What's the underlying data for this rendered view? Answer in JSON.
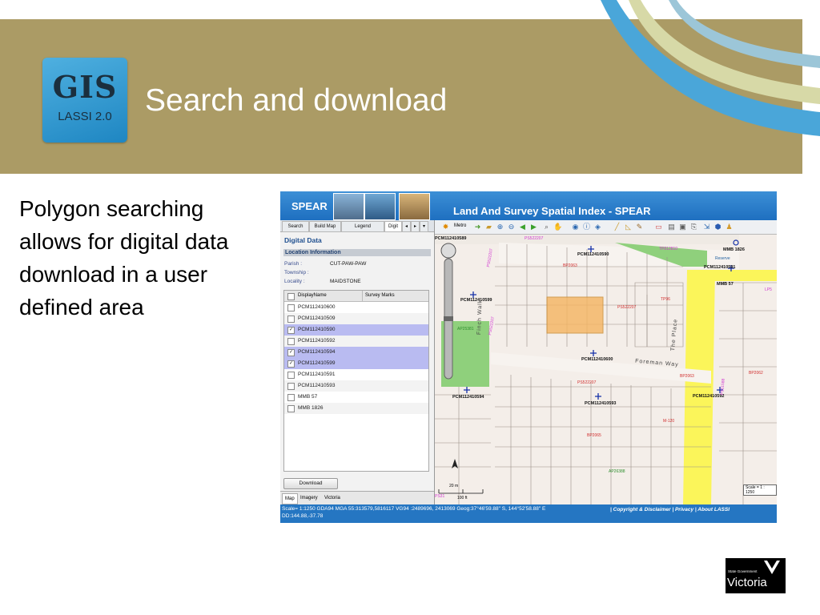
{
  "slide": {
    "title": "Search and download",
    "bullet": "Polygon searching allows for digital data download in a user defined area",
    "logo": {
      "title": "GIS",
      "subtitle": "LASSI 2.0"
    }
  },
  "app": {
    "brand": "SPEAR",
    "title": "Land And Survey Spatial Index - SPEAR",
    "tabs": [
      "Search",
      "Build Map",
      "Legend",
      "Digit"
    ],
    "panel_title": "Digital Data",
    "section": "Location Information",
    "fields": [
      {
        "label": "Parish :",
        "value": "CUT-PAW-PAW"
      },
      {
        "label": "Township :",
        "value": ""
      },
      {
        "label": "Locality :",
        "value": "MAIDSTONE"
      }
    ],
    "columns": [
      "DisplayName",
      "Survey Marks"
    ],
    "rows": [
      {
        "name": "PCM112410600",
        "checked": false
      },
      {
        "name": "PCM112410509",
        "checked": false
      },
      {
        "name": "PCM112410590",
        "checked": true
      },
      {
        "name": "PCM112410592",
        "checked": false
      },
      {
        "name": "PCM112410594",
        "checked": true
      },
      {
        "name": "PCM112410599",
        "checked": true
      },
      {
        "name": "PCM112410591",
        "checked": false
      },
      {
        "name": "PCM112410593",
        "checked": false
      },
      {
        "name": "MMB 57",
        "checked": false
      },
      {
        "name": "MMB 1826",
        "checked": false
      }
    ],
    "download_label": "Download",
    "bottom_tabs": [
      "Map",
      "Imagery",
      "Victoria"
    ],
    "toolbar_metro": "Metro",
    "map": {
      "points": [
        "PCM112410589",
        "PCM112410590",
        "PCM112410591",
        "PCM112410599",
        "PCM112410600",
        "PCM112410594",
        "PCM112410593",
        "PCM112410592",
        "MMB 1826",
        "MMB 57"
      ],
      "streets": [
        "Foreman Way",
        "Finch Walk",
        "The Place"
      ],
      "plans": [
        "PS522207",
        "TP812810",
        "BP2063",
        "PS522207",
        "PS522207",
        "TP96",
        "PS522207",
        "BP2063",
        "M-120",
        "BP2065",
        "PS522207",
        "AP25381",
        "AP26388",
        "LP5",
        "BP2062",
        "PS61588",
        "PS31"
      ],
      "reserve": "Reserve",
      "scale_bar": {
        "metric": "20 m",
        "imperial": "100 ft"
      },
      "scale_label": "Scale = 1 : 1250"
    },
    "status_line1": "Scale= 1:1250 GDA94 MGA 55:313579,5816117 VG94 :2489696, 2413069 Geog:37°46'59.88\" S, 144°52'58.88\" E",
    "status_line2": "DD:144.88,-37.78",
    "footer_links": [
      "Copyright & Disclaimer",
      "Privacy",
      "About LASSI"
    ]
  },
  "vic_logo": {
    "small": "State Government",
    "name": "Victoria"
  },
  "colors": {
    "banner": "#ab9b65",
    "header": "#1e6fc0",
    "selected_row": "#b9bbf1",
    "road": "#fbf55a",
    "park": "#8fd07c",
    "search_polygon": "#f5b460"
  }
}
